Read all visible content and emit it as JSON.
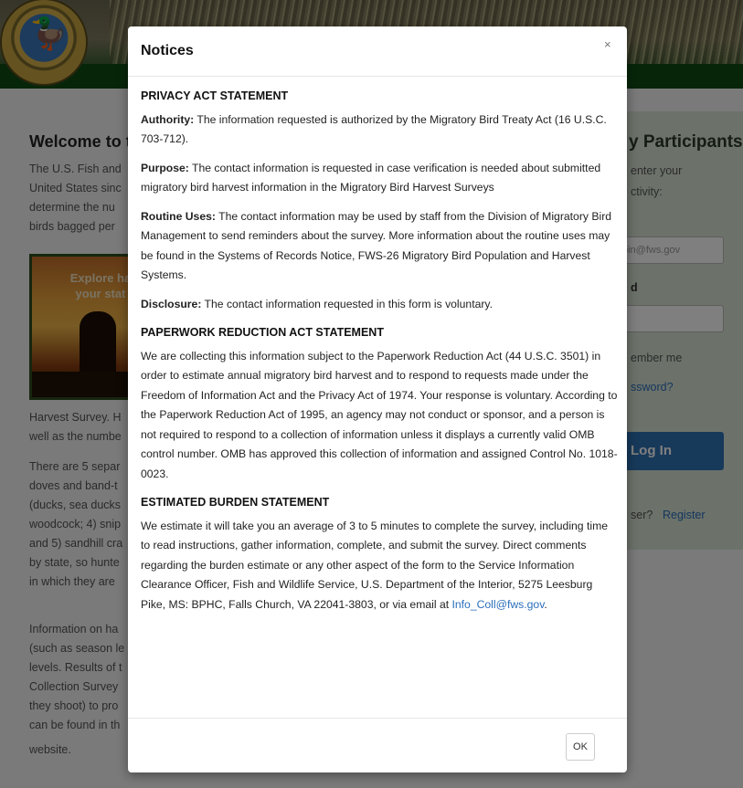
{
  "welcome": {
    "title": "Welcome to t",
    "lines": [
      "The U.S. Fish and",
      "United States sinc",
      "determine the nu",
      "birds bagged per"
    ],
    "hero_line1": "Explore ha",
    "hero_line2": "your stat",
    "after_hero_lines": [
      "Harvest Survey. H",
      "well as the numbe"
    ],
    "para2_lines": [
      "There are 5 separ",
      "doves and band-t",
      "(ducks, sea ducks",
      "woodcock; 4) snip",
      "and 5) sandhill cra",
      "by state, so hunte",
      "in which they are"
    ],
    "para3_lines": [
      "Information on ha",
      "(such as season le",
      "levels. Results of t",
      "Collection Survey",
      "they shoot) to pro",
      "can be found in th",
      "website."
    ]
  },
  "login": {
    "title": "y Participants",
    "line1": "enter your",
    "line2": "ctivity:",
    "email_placeholder": "pin@fws.gov",
    "field2_label": "d",
    "remember": "ember me",
    "forgot": "ssword?",
    "login_button": "Log In",
    "new_user": "ser?",
    "register": "Register"
  },
  "modal": {
    "title": "Notices",
    "close": "×",
    "privacy_heading": "PRIVACY ACT STATEMENT",
    "authority_label": "Authority:",
    "authority_text": " The information requested is authorized by the Migratory Bird Treaty Act (16 U.S.C. 703-712).",
    "purpose_label": "Purpose:",
    "purpose_text": " The contact information is requested in case verification is needed about submitted migratory bird harvest information in the Migratory Bird Harvest Surveys",
    "routine_label": "Routine Uses:",
    "routine_text": " The contact information may be used by staff from the Division of Migratory Bird Management to send reminders about the survey. More information about the routine uses may be found in the Systems of Records Notice, FWS-26 Migratory Bird Population and Harvest Systems.",
    "disclosure_label": "Disclosure:",
    "disclosure_text": " The contact information requested in this form is voluntary.",
    "paperwork_heading": "PAPERWORK REDUCTION ACT STATEMENT",
    "paperwork_text": "We are collecting this information subject to the Paperwork Reduction Act (44 U.S.C. 3501) in order to estimate annual migratory bird harvest and to respond to requests made under the Freedom of Information Act and the Privacy Act of 1974. Your response is voluntary. According to the Paperwork Reduction Act of 1995, an agency may not conduct or sponsor, and a person is not required to respond to a collection of information unless it displays a currently valid OMB control number. OMB has approved this collection of information and assigned Control No. 1018-0023.",
    "burden_heading": "ESTIMATED BURDEN STATEMENT",
    "burden_text": "We estimate it will take you an average of 3 to 5 minutes to complete the survey, including time to read instructions, gather information, complete, and submit the survey. Direct comments regarding the burden estimate or any other aspect of the form to the Service Information Clearance Officer, Fish and Wildlife Service, U.S. Department of the Interior, 5275 Leesburg Pike, MS: BPHC, Falls Church, VA 22041-3803, or via email at ",
    "burden_email": "Info_Coll@fws.gov",
    "burden_end": ".",
    "ok_button": "OK"
  }
}
